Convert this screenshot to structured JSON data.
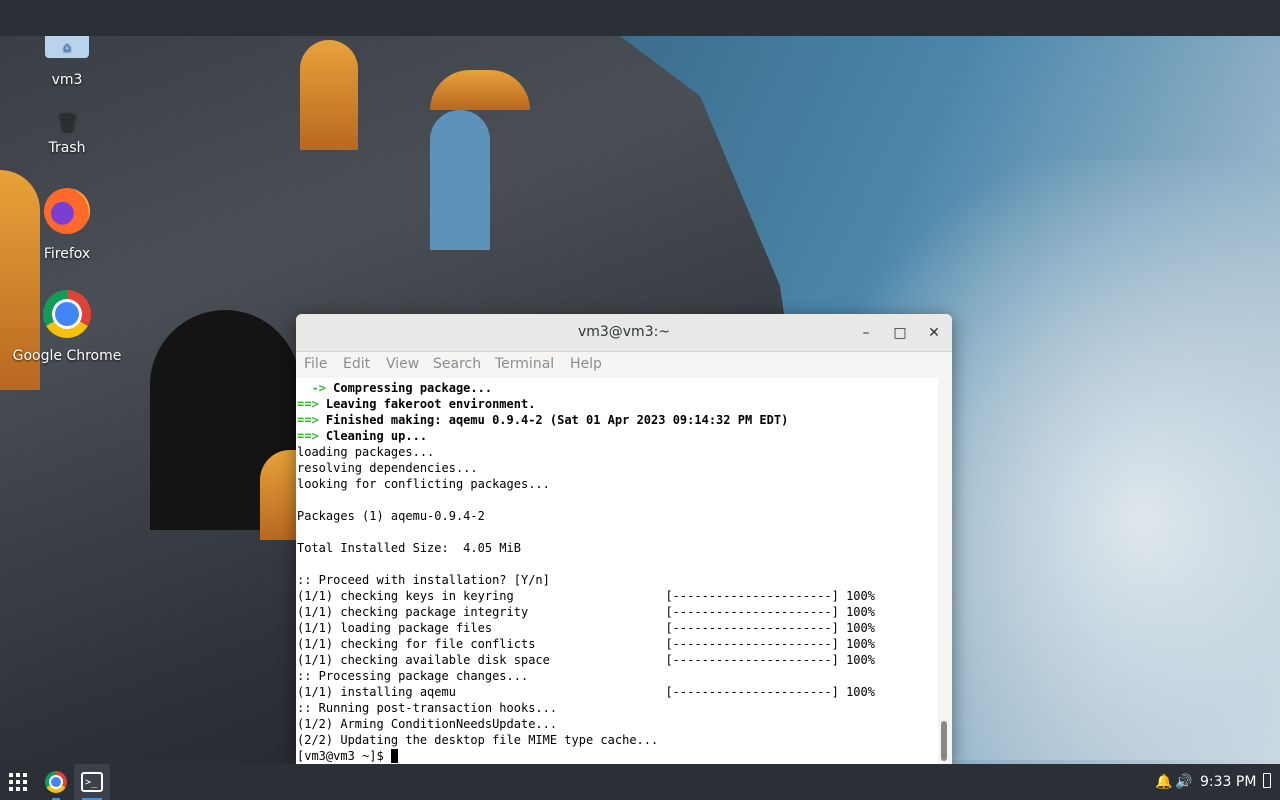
{
  "desktop": {
    "icons": [
      {
        "label": "vm3"
      },
      {
        "label": "Trash"
      },
      {
        "label": "Firefox"
      },
      {
        "label": "Google Chrome"
      }
    ]
  },
  "terminal": {
    "title": "vm3@vm3:~",
    "window_buttons": {
      "minimize": "–",
      "maximize": "□",
      "close": "✕"
    },
    "menu": [
      "File",
      "Edit",
      "View",
      "Search",
      "Terminal",
      "Help"
    ],
    "lines": [
      {
        "prefix": "  ->",
        "text": " Compressing package...",
        "bold": true
      },
      {
        "prefix": "==>",
        "text": " Leaving fakeroot environment.",
        "bold": true
      },
      {
        "prefix": "==>",
        "text": " Finished making: aqemu 0.9.4-2 (Sat 01 Apr 2023 09:14:32 PM EDT)",
        "bold": true
      },
      {
        "prefix": "==>",
        "text": " Cleaning up...",
        "bold": true
      },
      {
        "prefix": "",
        "text": "loading packages...",
        "bold": false
      },
      {
        "prefix": "",
        "text": "resolving dependencies...",
        "bold": false
      },
      {
        "prefix": "",
        "text": "looking for conflicting packages...",
        "bold": false
      },
      {
        "prefix": "",
        "text": "",
        "bold": false
      },
      {
        "prefix": "",
        "text": "Packages (1) aqemu-0.9.4-2",
        "bold": false
      },
      {
        "prefix": "",
        "text": "",
        "bold": false
      },
      {
        "prefix": "",
        "text": "Total Installed Size:  4.05 MiB",
        "bold": false
      },
      {
        "prefix": "",
        "text": "",
        "bold": false
      },
      {
        "prefix": "",
        "text": ":: Proceed with installation? [Y/n]",
        "bold": false
      },
      {
        "prefix": "",
        "text": "(1/1) checking keys in keyring                     [----------------------] 100%",
        "bold": false
      },
      {
        "prefix": "",
        "text": "(1/1) checking package integrity                   [----------------------] 100%",
        "bold": false
      },
      {
        "prefix": "",
        "text": "(1/1) loading package files                        [----------------------] 100%",
        "bold": false
      },
      {
        "prefix": "",
        "text": "(1/1) checking for file conflicts                  [----------------------] 100%",
        "bold": false
      },
      {
        "prefix": "",
        "text": "(1/1) checking available disk space                [----------------------] 100%",
        "bold": false
      },
      {
        "prefix": "",
        "text": ":: Processing package changes...",
        "bold": false
      },
      {
        "prefix": "",
        "text": "(1/1) installing aqemu                             [----------------------] 100%",
        "bold": false
      },
      {
        "prefix": "",
        "text": ":: Running post-transaction hooks...",
        "bold": false
      },
      {
        "prefix": "",
        "text": "(1/2) Arming ConditionNeedsUpdate...",
        "bold": false
      },
      {
        "prefix": "",
        "text": "(2/2) Updating the desktop file MIME type cache...",
        "bold": false
      }
    ],
    "prompt": "[vm3@vm3 ~]$ "
  },
  "taskbar": {
    "clock": "9:33 PM",
    "tray_icons": [
      "bell-icon",
      "volume-icon",
      "battery-icon"
    ]
  },
  "colors": {
    "arrow_green": "#2ec22e",
    "panel": "#2b2f36",
    "active_indicator": "#4a90d9"
  }
}
